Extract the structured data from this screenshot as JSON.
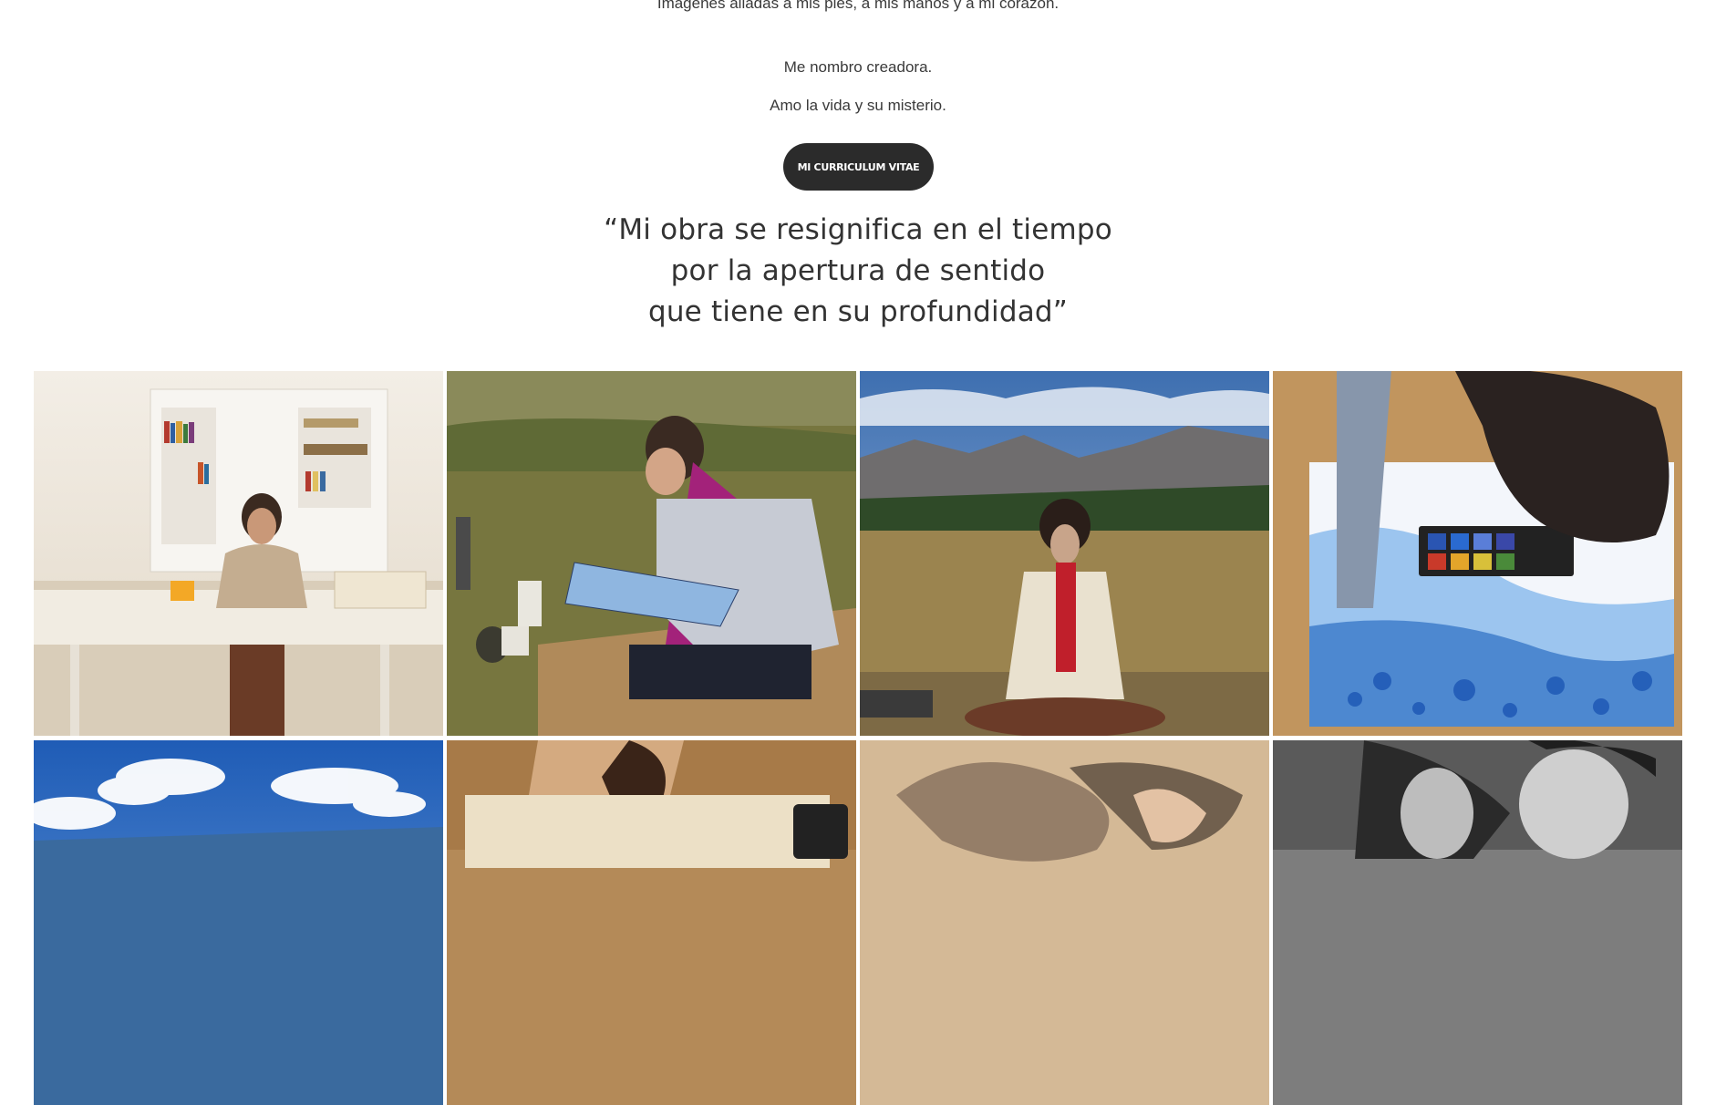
{
  "intro": {
    "line1": "Imágenes aliadas a mis pies, a mis manos y a mi corazón.",
    "line2": "Me nombro creadora.",
    "line3": "Amo la vida y su misterio."
  },
  "cv_button": {
    "label": "MI CURRICULUM VITAE"
  },
  "quote": {
    "lines": [
      "“Mi obra se resignifica en el tiempo",
      "por la apertura de sentido",
      "que tiene en su profundidad”"
    ]
  },
  "gallery": {
    "photos": [
      {
        "id": "studio-desk-painting",
        "colors": {
          "bg": "#e9e2d6",
          "accent": "#c9b89a"
        }
      },
      {
        "id": "field-sketching-scarf",
        "colors": {
          "bg": "#7b7a45",
          "accent": "#a2287a"
        }
      },
      {
        "id": "mountain-meditation",
        "colors": {
          "bg": "#8e7a4e",
          "accent": "#4b6ea8"
        }
      },
      {
        "id": "watercolor-top-view",
        "colors": {
          "bg": "#c79a63",
          "accent": "#3a78c8"
        }
      },
      {
        "id": "blue-sky-clouds",
        "colors": {
          "bg": "#2e6ec2",
          "accent": "#ffffff"
        }
      },
      {
        "id": "writing-close-up",
        "colors": {
          "bg": "#b98c58",
          "accent": "#e7d6b4"
        }
      },
      {
        "id": "charcoal-drawing",
        "colors": {
          "bg": "#d8bfa1",
          "accent": "#5a4a3c"
        }
      },
      {
        "id": "black-white-portrait",
        "colors": {
          "bg": "#8a8a8a",
          "accent": "#2a2a2a"
        }
      }
    ]
  },
  "colors": {
    "text": "#333333",
    "button_bg": "#2b2b2b",
    "button_text": "#ffffff",
    "background": "#ffffff"
  }
}
